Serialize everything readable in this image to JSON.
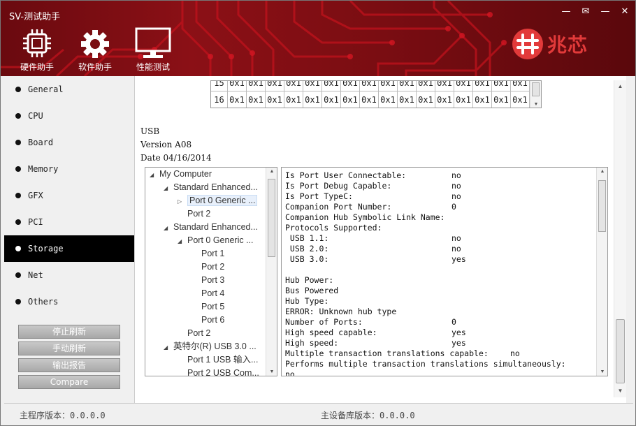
{
  "window": {
    "title": "SV-测试助手",
    "controls": [
      "—",
      "✉",
      "—",
      "✕"
    ]
  },
  "toolbar": [
    {
      "label": "硬件助手",
      "icon": "chip-icon"
    },
    {
      "label": "软件助手",
      "icon": "gear-icon"
    },
    {
      "label": "性能测试",
      "icon": "monitor-icon"
    }
  ],
  "brand": {
    "name": "兆芯",
    "accent": "#e23a3a"
  },
  "sidebar": {
    "items": [
      {
        "label": "General",
        "active": false
      },
      {
        "label": "CPU",
        "active": false
      },
      {
        "label": "Board",
        "active": false
      },
      {
        "label": "Memory",
        "active": false
      },
      {
        "label": "GFX",
        "active": false
      },
      {
        "label": "PCI",
        "active": false
      },
      {
        "label": "Storage",
        "active": true
      },
      {
        "label": "Net",
        "active": false
      },
      {
        "label": "Others",
        "active": false
      }
    ],
    "buttons": [
      "停止刷新",
      "手动刷新",
      "输出报告",
      "Compare"
    ]
  },
  "grid": {
    "rows": [
      {
        "header": "15",
        "cells": [
          "0x1",
          "0x1",
          "0x1",
          "0x1",
          "0x1",
          "0x1",
          "0x1",
          "0x1",
          "0x1",
          "0x1",
          "0x1",
          "0x1",
          "0x1",
          "0x1",
          "0x1",
          "0x1"
        ]
      },
      {
        "header": "16",
        "cells": [
          "0x1",
          "0x1",
          "0x1",
          "0x1",
          "0x1",
          "0x1",
          "0x1",
          "0x1",
          "0x1",
          "0x1",
          "0x1",
          "0x1",
          "0x1",
          "0x1",
          "0x1",
          "0x1"
        ]
      }
    ]
  },
  "info": {
    "type": "USB",
    "version": "Version A08",
    "date": "Date 04/16/2014"
  },
  "tree": [
    {
      "label": "My Computer",
      "arrow": "◢",
      "selected": false
    },
    {
      "label": "Standard Enhanced...",
      "arrow": "◢",
      "selected": false
    },
    {
      "label": "Port 0 Generic ...",
      "arrow": "▷",
      "selected": true
    },
    {
      "label": "Port 2",
      "arrow": "",
      "selected": false
    },
    {
      "label": "Standard Enhanced...",
      "arrow": "◢",
      "selected": false
    },
    {
      "label": "Port 0 Generic ...",
      "arrow": "◢",
      "selected": false
    },
    {
      "label": "Port 1",
      "arrow": "",
      "selected": false
    },
    {
      "label": "Port 2",
      "arrow": "",
      "selected": false
    },
    {
      "label": "Port 3",
      "arrow": "",
      "selected": false
    },
    {
      "label": "Port 4",
      "arrow": "",
      "selected": false
    },
    {
      "label": "Port 5",
      "arrow": "",
      "selected": false
    },
    {
      "label": "Port 6",
      "arrow": "",
      "selected": false
    },
    {
      "label": "Port 2",
      "arrow": "",
      "selected": false
    },
    {
      "label": "英特尔(R) USB 3.0 ...",
      "arrow": "◢",
      "selected": false
    },
    {
      "label": "Port 1 USB 输入...",
      "arrow": "",
      "selected": false
    },
    {
      "label": "Port 2 USB Com...",
      "arrow": "",
      "selected": false
    }
  ],
  "detail": [
    {
      "key": "Is Port User Connectable:",
      "value": "no"
    },
    {
      "key": "Is Port Debug Capable:",
      "value": "no"
    },
    {
      "key": "Is Port TypeC:",
      "value": "no"
    },
    {
      "key": "Companion Port Number:",
      "value": "0"
    },
    {
      "key": "Companion Hub Symbolic Link Name:",
      "value": ""
    },
    {
      "key": "Protocols Supported:",
      "value": ""
    },
    {
      "key": " USB 1.1:",
      "value": "no"
    },
    {
      "key": " USB 2.0:",
      "value": "no"
    },
    {
      "key": " USB 3.0:",
      "value": "yes"
    },
    {
      "key": "",
      "value": ""
    },
    {
      "key": "Hub Power:",
      "value": ""
    },
    {
      "key": "Bus Powered",
      "value": ""
    },
    {
      "key": "Hub Type:",
      "value": ""
    },
    {
      "key": "ERROR: Unknown hub type",
      "value": ""
    },
    {
      "key": "Number of Ports:",
      "value": "0"
    },
    {
      "key": "High speed capable:",
      "value": "yes"
    },
    {
      "key": "High speed:",
      "value": "yes"
    },
    {
      "key": "Multiple transaction translations capable:",
      "value": "no"
    },
    {
      "key": "Performs multiple transaction translations simultaneously:",
      "value": ""
    },
    {
      "key": "no",
      "value": ""
    }
  ],
  "status": {
    "main_version": "主程序版本：0.0.0.0",
    "db_version": "主设备库版本：0.0.0.0"
  }
}
